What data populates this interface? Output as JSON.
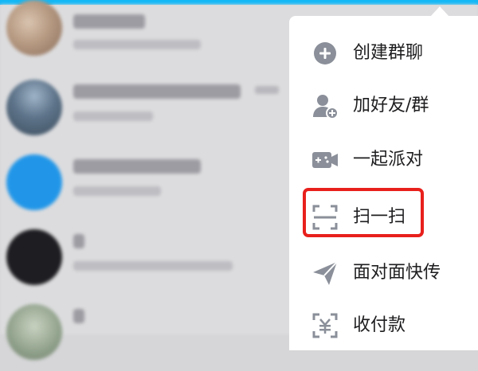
{
  "menu": {
    "items": [
      {
        "label": "创建群聊",
        "icon": "plus-circle-icon"
      },
      {
        "label": "加好友/群",
        "icon": "add-friend-icon"
      },
      {
        "label": "一起派对",
        "icon": "party-game-icon"
      },
      {
        "label": "扫一扫",
        "icon": "scan-icon"
      },
      {
        "label": "面对面快传",
        "icon": "paper-plane-icon"
      },
      {
        "label": "收付款",
        "icon": "payment-icon"
      }
    ]
  },
  "colors": {
    "accent": "#12b7f5",
    "highlight": "#e8201c",
    "icon": "#8a8f99"
  }
}
